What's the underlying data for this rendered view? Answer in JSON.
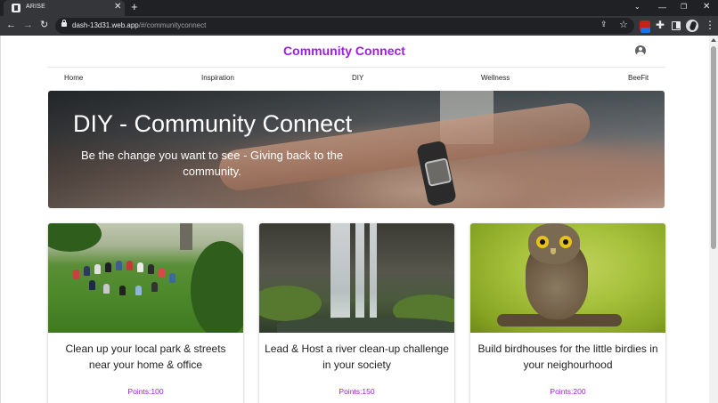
{
  "browser": {
    "tab_title": "ARISE",
    "tab_close": "✕",
    "new_tab": "+",
    "url_host": "dash-13d31.web.app",
    "url_path": "/#/communityconnect",
    "window_controls": {
      "tab_menu": "⌄",
      "minimize": "—",
      "restore": "❐",
      "close": "✕"
    },
    "nav": {
      "back": "←",
      "forward": "→",
      "reload": "↻"
    },
    "icons": [
      "share-icon",
      "star-icon",
      "extension-icon",
      "puzzle-icon",
      "side-panel-icon",
      "profile-avatar",
      "kebab-menu-icon"
    ],
    "share_glyph": "⇪",
    "star_glyph": "☆",
    "puzzle_glyph": "✚",
    "kebab_glyph": "⋮"
  },
  "site": {
    "title": "Community Connect",
    "accent_color": "#9c1fd9",
    "account_icon": "account-circle-icon"
  },
  "nav_items": [
    "Home",
    "Inspiration",
    "DIY",
    "Wellness",
    "BeeFit"
  ],
  "hero": {
    "title": "DIY - Community Connect",
    "subtitle": "Be the change you want to see - Giving back to the community."
  },
  "cards": [
    {
      "title": "Clean up your local park & streets near your home & office",
      "points": "Points:100",
      "image": "people-in-park-photo"
    },
    {
      "title": "Lead & Host a river clean-up challenge in your society",
      "points": "Points:150",
      "image": "waterfall-photo"
    },
    {
      "title": "Build birdhouses for the little birdies in your neighourhood",
      "points": "Points:200",
      "image": "owl-photo"
    }
  ]
}
